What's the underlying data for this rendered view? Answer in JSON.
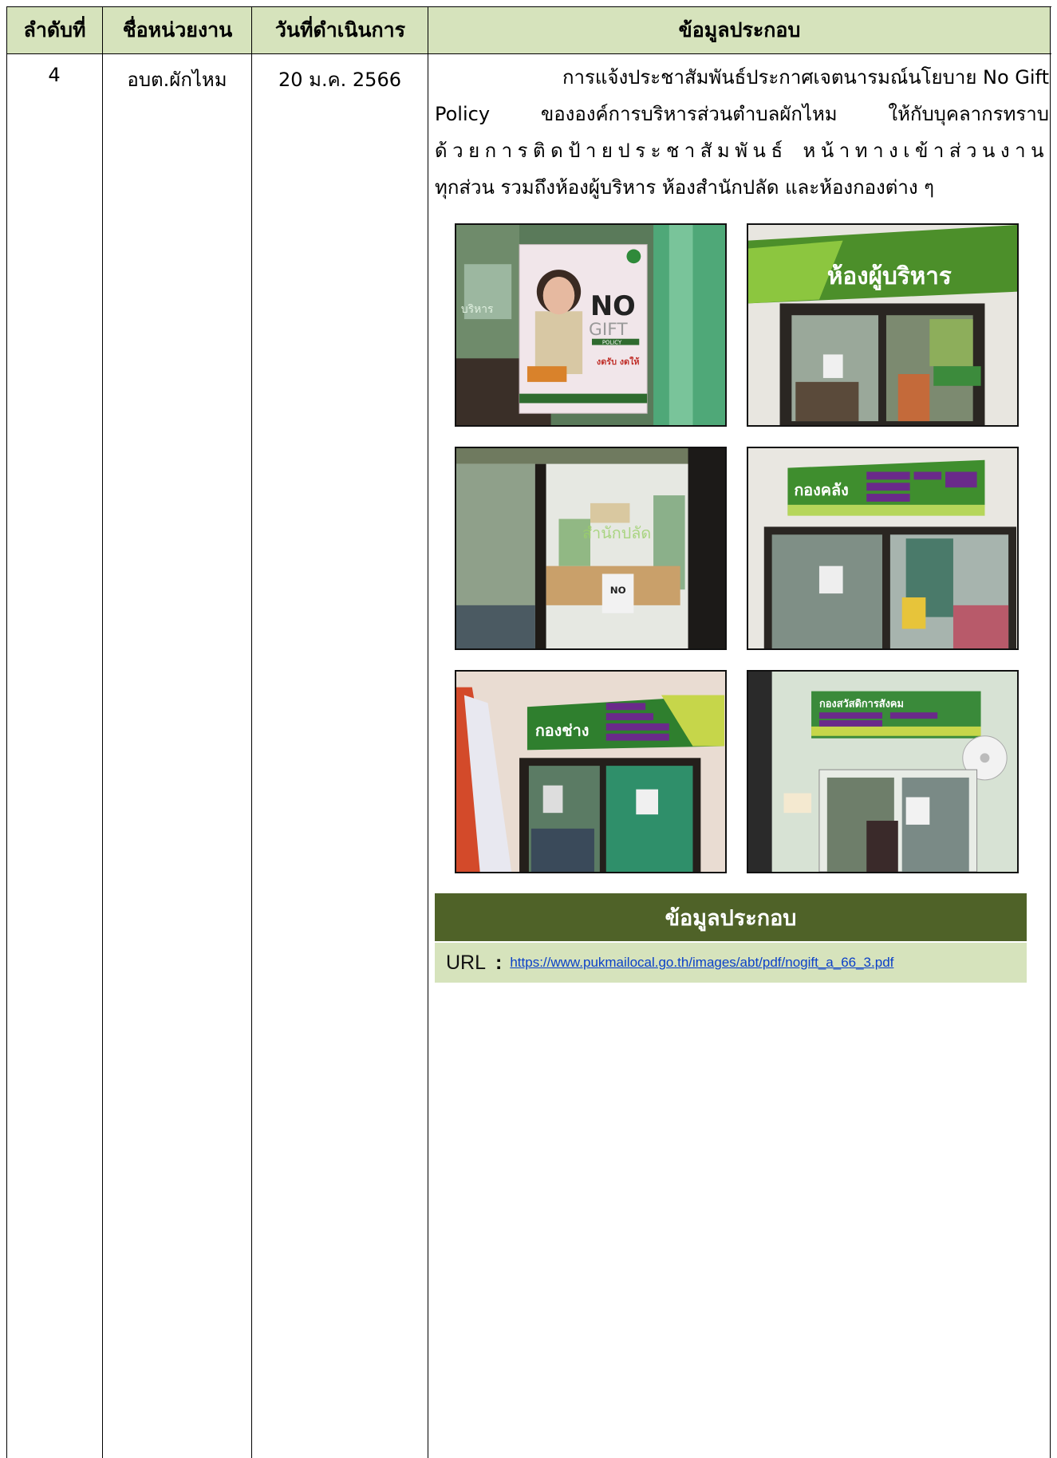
{
  "table": {
    "headers": [
      "ลำดับที่",
      "ชื่อหน่วยงาน",
      "วันที่ดำเนินการ",
      "ข้อมูลประกอบ"
    ],
    "row": {
      "number": "4",
      "department": "อบต.ผักไหม",
      "date": "20 ม.ค. 2566",
      "description_lines": [
        "การแจ้งประชาสัมพันธ์ประกาศเจตนารมณ์นโยบาย No Gift",
        "Policy  ขององค์การบริหารส่วนตำบลผักไหม ให้กับบุคลากรทราบ",
        "ด้วยการติดป้ายประชาสัมพันธ์ หน้าทางเข้าส่วนงาน",
        "ทุกส่วน รวมถึงห้องผู้บริหาร ห้องสำนักปลัด และห้องกองต่าง ๆ"
      ]
    }
  },
  "photos": {
    "p1": {
      "poster_top": "NO",
      "poster_mid": "GIFT",
      "poster_tag": "POLICY",
      "poster_red": "งดรับ งดให้",
      "wall_text": "บริหาร"
    },
    "p2": {
      "sign": "ห้องผู้บริหาร"
    },
    "p3": {
      "glass_text": "สำนักปลัด",
      "poster": "NO"
    },
    "p4": {
      "sign": "กองคลัง"
    },
    "p5": {
      "sign": "กองช่าง"
    },
    "p6": {
      "sign": "กองสวัสดิการสังคม"
    }
  },
  "info": {
    "title": "ข้อมูลประกอบ",
    "label": "URL",
    "colon": ":",
    "url": "https://www.pukmailocal.go.th/images/abt/pdf/nogift_a_66_3.pdf"
  },
  "colors": {
    "header_bg": "#d6e3bc",
    "info_head_bg": "#4f6228",
    "link": "#0b40c8"
  }
}
